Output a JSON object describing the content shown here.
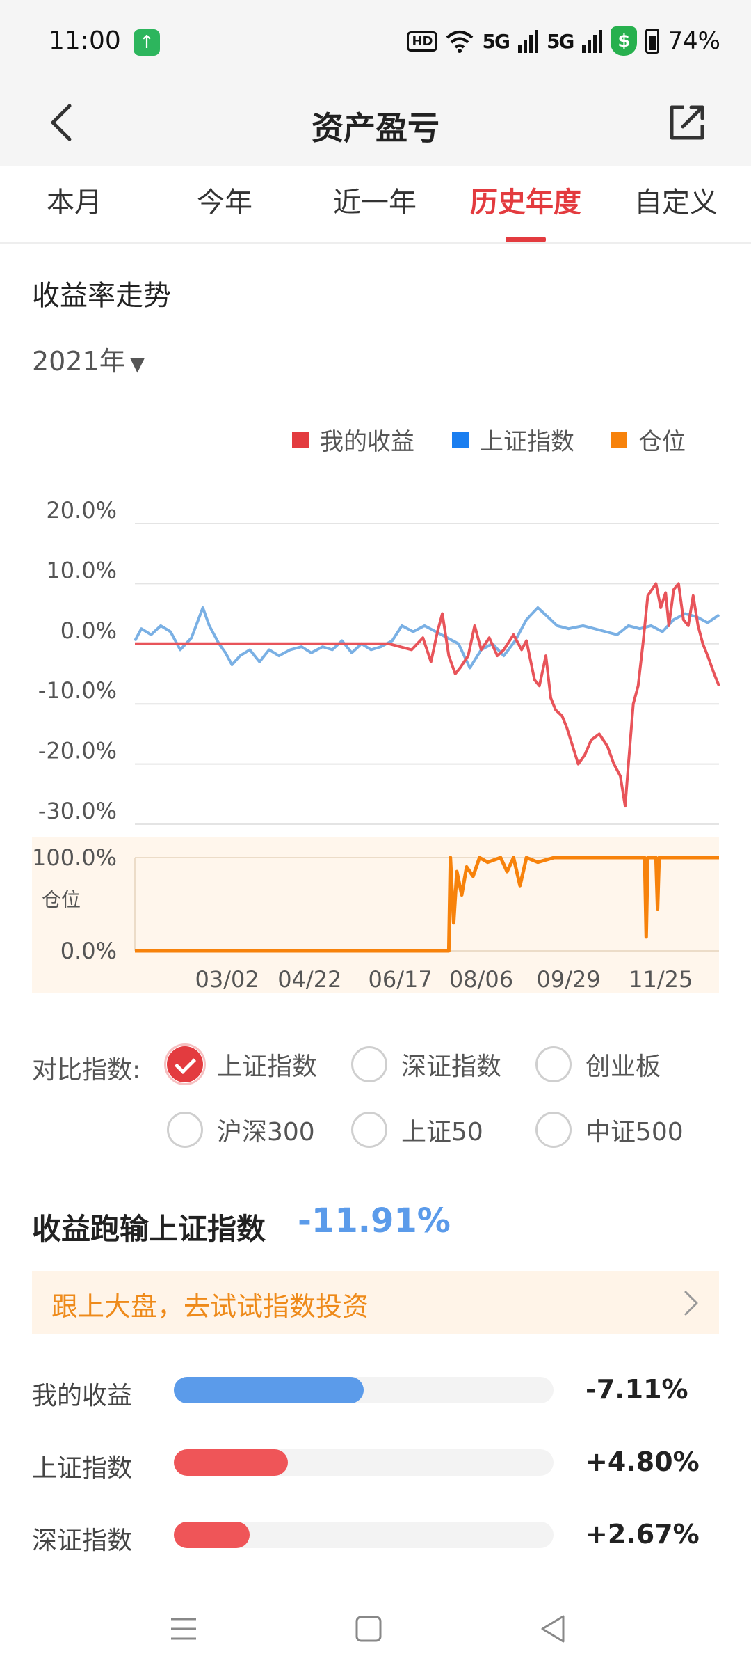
{
  "status_bar": {
    "time": "11:00",
    "hd_label": "HD",
    "network_1": "5G",
    "network_2": "5G",
    "battery": "74%",
    "icons": [
      "app-notification-icon",
      "wifi-icon",
      "signal-icon",
      "security-shield-icon",
      "battery-icon"
    ]
  },
  "header": {
    "title": "资产盈亏",
    "icons": [
      "back-arrow-icon",
      "share-icon"
    ]
  },
  "tabs": [
    {
      "label": "本月",
      "active": false
    },
    {
      "label": "今年",
      "active": false
    },
    {
      "label": "近一年",
      "active": false
    },
    {
      "label": "历史年度",
      "active": true
    },
    {
      "label": "自定义",
      "active": false
    }
  ],
  "section": {
    "title": "收益率走势",
    "year_selected": "2021年"
  },
  "colors": {
    "accent": "#e33b3f",
    "my_return": "#e8545a",
    "shanghai": "#7ab0e4",
    "position": "#f7820b",
    "outperform_negative": "#5b9bea"
  },
  "chart_data": [
    {
      "type": "line",
      "legend_placement": "top-right",
      "legend": [
        {
          "label": "我的收益",
          "color": "#e8545a"
        },
        {
          "label": "上证指数",
          "color": "#1a7ef0"
        },
        {
          "label": "仓位",
          "color": "#f7820b"
        }
      ],
      "y_ticks": [
        "20.0%",
        "10.0%",
        "0.0%",
        "-10.0%",
        "-20.0%",
        "-30.0%"
      ],
      "ylim": [
        -30,
        20
      ],
      "x_domain": [
        "2021-01-04",
        "2021-12-31"
      ],
      "grid": true,
      "series": [
        {
          "name": "我的收益",
          "color": "#e8545a",
          "x": [
            "2021-01-04",
            "2021-06-10",
            "2021-06-24",
            "2021-07-01",
            "2021-07-06",
            "2021-07-10",
            "2021-07-13",
            "2021-07-17",
            "2021-07-21",
            "2021-07-24",
            "2021-07-29",
            "2021-08-02",
            "2021-08-06",
            "2021-08-11",
            "2021-08-16",
            "2021-08-20",
            "2021-08-26",
            "2021-08-31",
            "2021-09-03",
            "2021-09-08",
            "2021-09-11",
            "2021-09-15",
            "2021-09-18",
            "2021-09-21",
            "2021-09-25",
            "2021-09-28",
            "2021-10-05",
            "2021-10-09",
            "2021-10-13",
            "2021-10-18",
            "2021-10-23",
            "2021-10-27",
            "2021-10-31",
            "2021-11-03",
            "2021-11-05",
            "2021-11-08",
            "2021-11-11",
            "2021-11-14",
            "2021-11-17",
            "2021-11-22",
            "2021-11-25",
            "2021-11-28",
            "2021-11-30",
            "2021-12-03",
            "2021-12-06",
            "2021-12-09",
            "2021-12-12",
            "2021-12-15",
            "2021-12-18",
            "2021-12-21",
            "2021-12-24",
            "2021-12-28",
            "2021-12-31"
          ],
          "y": [
            0.0,
            0.0,
            -1.0,
            1.0,
            -3.0,
            2.0,
            5.0,
            -2.0,
            -5.0,
            -4.0,
            -2.0,
            3.0,
            -1.0,
            1.0,
            -2.0,
            -1.0,
            1.5,
            -1.0,
            0.5,
            -6.0,
            -7.0,
            -2.0,
            -9.0,
            -11.0,
            -12.0,
            -14.0,
            -20.0,
            -18.5,
            -16.0,
            -15.0,
            -17.0,
            -20.0,
            -22.0,
            -27.0,
            -20.0,
            -10.0,
            -7.0,
            0.0,
            8.0,
            10.0,
            6.0,
            8.5,
            3.0,
            9.0,
            10.0,
            4.0,
            3.0,
            8.0,
            3.0,
            0.0,
            -2.0,
            -5.0,
            -7.0
          ]
        },
        {
          "name": "上证指数",
          "color": "#7ab0e4",
          "x": [
            "2021-01-04",
            "2021-01-08",
            "2021-01-14",
            "2021-01-20",
            "2021-01-26",
            "2021-02-01",
            "2021-02-08",
            "2021-02-15",
            "2021-02-19",
            "2021-02-25",
            "2021-03-01",
            "2021-03-05",
            "2021-03-10",
            "2021-03-16",
            "2021-03-22",
            "2021-03-28",
            "2021-04-03",
            "2021-04-10",
            "2021-04-17",
            "2021-04-23",
            "2021-04-30",
            "2021-05-06",
            "2021-05-12",
            "2021-05-18",
            "2021-05-24",
            "2021-05-30",
            "2021-06-05",
            "2021-06-12",
            "2021-06-18",
            "2021-06-25",
            "2021-07-02",
            "2021-07-09",
            "2021-07-16",
            "2021-07-23",
            "2021-07-30",
            "2021-08-06",
            "2021-08-13",
            "2021-08-20",
            "2021-08-27",
            "2021-09-03",
            "2021-09-10",
            "2021-09-16",
            "2021-09-22",
            "2021-09-29",
            "2021-10-08",
            "2021-10-15",
            "2021-10-22",
            "2021-10-29",
            "2021-11-05",
            "2021-11-12",
            "2021-11-19",
            "2021-11-26",
            "2021-12-03",
            "2021-12-10",
            "2021-12-17",
            "2021-12-24",
            "2021-12-31"
          ],
          "y": [
            0.5,
            2.5,
            1.5,
            3.0,
            2.0,
            -1.0,
            1.0,
            6.0,
            3.0,
            0.0,
            -1.5,
            -3.5,
            -2.0,
            -1.0,
            -3.0,
            -1.0,
            -2.0,
            -1.0,
            -0.5,
            -1.5,
            -0.5,
            -1.0,
            0.5,
            -1.5,
            0.0,
            -1.0,
            -0.5,
            0.5,
            3.0,
            2.0,
            3.0,
            2.0,
            1.0,
            0.0,
            -4.0,
            -1.0,
            0.0,
            -2.0,
            0.5,
            4.0,
            6.0,
            4.5,
            3.0,
            2.5,
            3.0,
            2.5,
            2.0,
            1.5,
            3.0,
            2.5,
            3.0,
            2.0,
            4.0,
            5.0,
            4.5,
            3.5,
            4.8
          ]
        }
      ]
    },
    {
      "type": "area",
      "y_label": "仓位",
      "y_ticks": [
        "100.0%",
        "0.0%"
      ],
      "ylim": [
        0,
        100
      ],
      "x_tick_labels": [
        "03/02",
        "04/22",
        "06/17",
        "08/06",
        "09/29",
        "11/25"
      ],
      "x_domain": [
        "2021-01-04",
        "2021-12-31"
      ],
      "series": [
        {
          "name": "仓位",
          "color": "#f7820b",
          "x": [
            "2021-01-04",
            "2021-07-17",
            "2021-07-18",
            "2021-07-20",
            "2021-07-22",
            "2021-07-25",
            "2021-07-28",
            "2021-08-01",
            "2021-08-05",
            "2021-08-10",
            "2021-08-18",
            "2021-08-22",
            "2021-08-26",
            "2021-08-30",
            "2021-09-03",
            "2021-09-10",
            "2021-09-20",
            "2021-10-10",
            "2021-11-01",
            "2021-11-15",
            "2021-11-16",
            "2021-11-17",
            "2021-11-22",
            "2021-11-23",
            "2021-11-24",
            "2021-12-31"
          ],
          "y": [
            0,
            0,
            100,
            30,
            85,
            60,
            90,
            80,
            100,
            95,
            100,
            85,
            100,
            70,
            100,
            95,
            100,
            100,
            100,
            100,
            15,
            100,
            100,
            45,
            100,
            100
          ]
        }
      ]
    }
  ],
  "compare": {
    "label": "对比指数:",
    "options": [
      {
        "label": "上证指数",
        "checked": true
      },
      {
        "label": "深证指数",
        "checked": false
      },
      {
        "label": "创业板",
        "checked": false
      },
      {
        "label": "沪深300",
        "checked": false
      },
      {
        "label": "上证50",
        "checked": false
      },
      {
        "label": "中证500",
        "checked": false
      }
    ]
  },
  "performance": {
    "title": "收益跑输上证指数",
    "value": "-11.91%",
    "banner": "跟上大盘，去试试指数投资"
  },
  "comparison_rows": [
    {
      "label": "我的收益",
      "value": "-7.11%",
      "fill_fraction": 0.5,
      "color": "#5b9bea"
    },
    {
      "label": "上证指数",
      "value": "+4.80%",
      "fill_fraction": 0.3,
      "color": "#ef5558"
    },
    {
      "label": "深证指数",
      "value": "+2.67%",
      "fill_fraction": 0.2,
      "color": "#ef5558"
    }
  ],
  "nav_bar": {
    "icons": [
      "menu-icon",
      "home-icon",
      "back-icon"
    ]
  }
}
